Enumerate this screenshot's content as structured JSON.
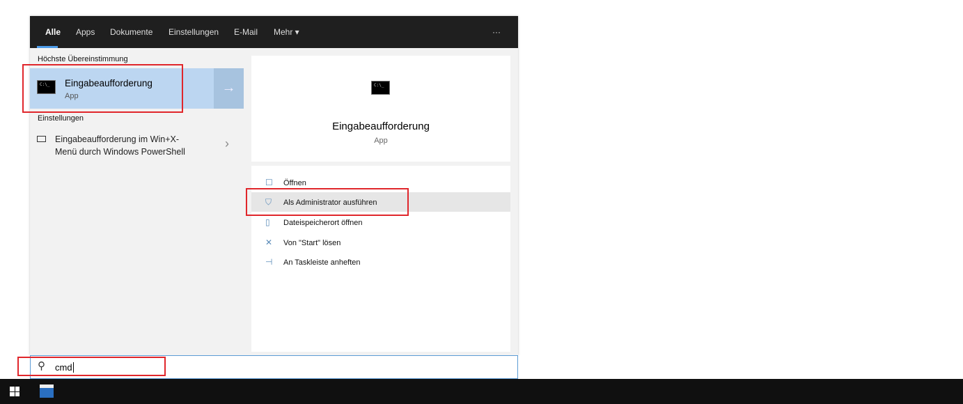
{
  "tabs": [
    {
      "label": "Alle",
      "active": true
    },
    {
      "label": "Apps"
    },
    {
      "label": "Dokumente"
    },
    {
      "label": "Einstellungen"
    },
    {
      "label": "E-Mail"
    },
    {
      "label": "Mehr ▾"
    }
  ],
  "more_options": "···",
  "best_match": {
    "heading": "Höchste Übereinstimmung",
    "title": "Eingabeaufforderung",
    "subtitle": "App",
    "icon": "command-prompt-icon"
  },
  "settings": {
    "heading": "Einstellungen",
    "item": {
      "line1": "Eingabeaufforderung im Win+X-",
      "line2": "Menü durch Windows PowerShell"
    }
  },
  "preview": {
    "title": "Eingabeaufforderung",
    "subtitle": "App"
  },
  "actions": [
    {
      "label": "Öffnen",
      "icon": "open-icon"
    },
    {
      "label": "Als Administrator ausführen",
      "icon": "admin-shield-icon",
      "highlighted": true
    },
    {
      "label": "Dateispeicherort öffnen",
      "icon": "file-location-icon"
    },
    {
      "label": "Von \"Start\" lösen",
      "icon": "unpin-icon"
    },
    {
      "label": "An Taskleiste anheften",
      "icon": "pin-icon"
    }
  ],
  "search": {
    "value": "cmd"
  },
  "colors": {
    "accent": "#4c9be8",
    "highlight": "#e0262b",
    "selected": "#bcd6f1"
  }
}
